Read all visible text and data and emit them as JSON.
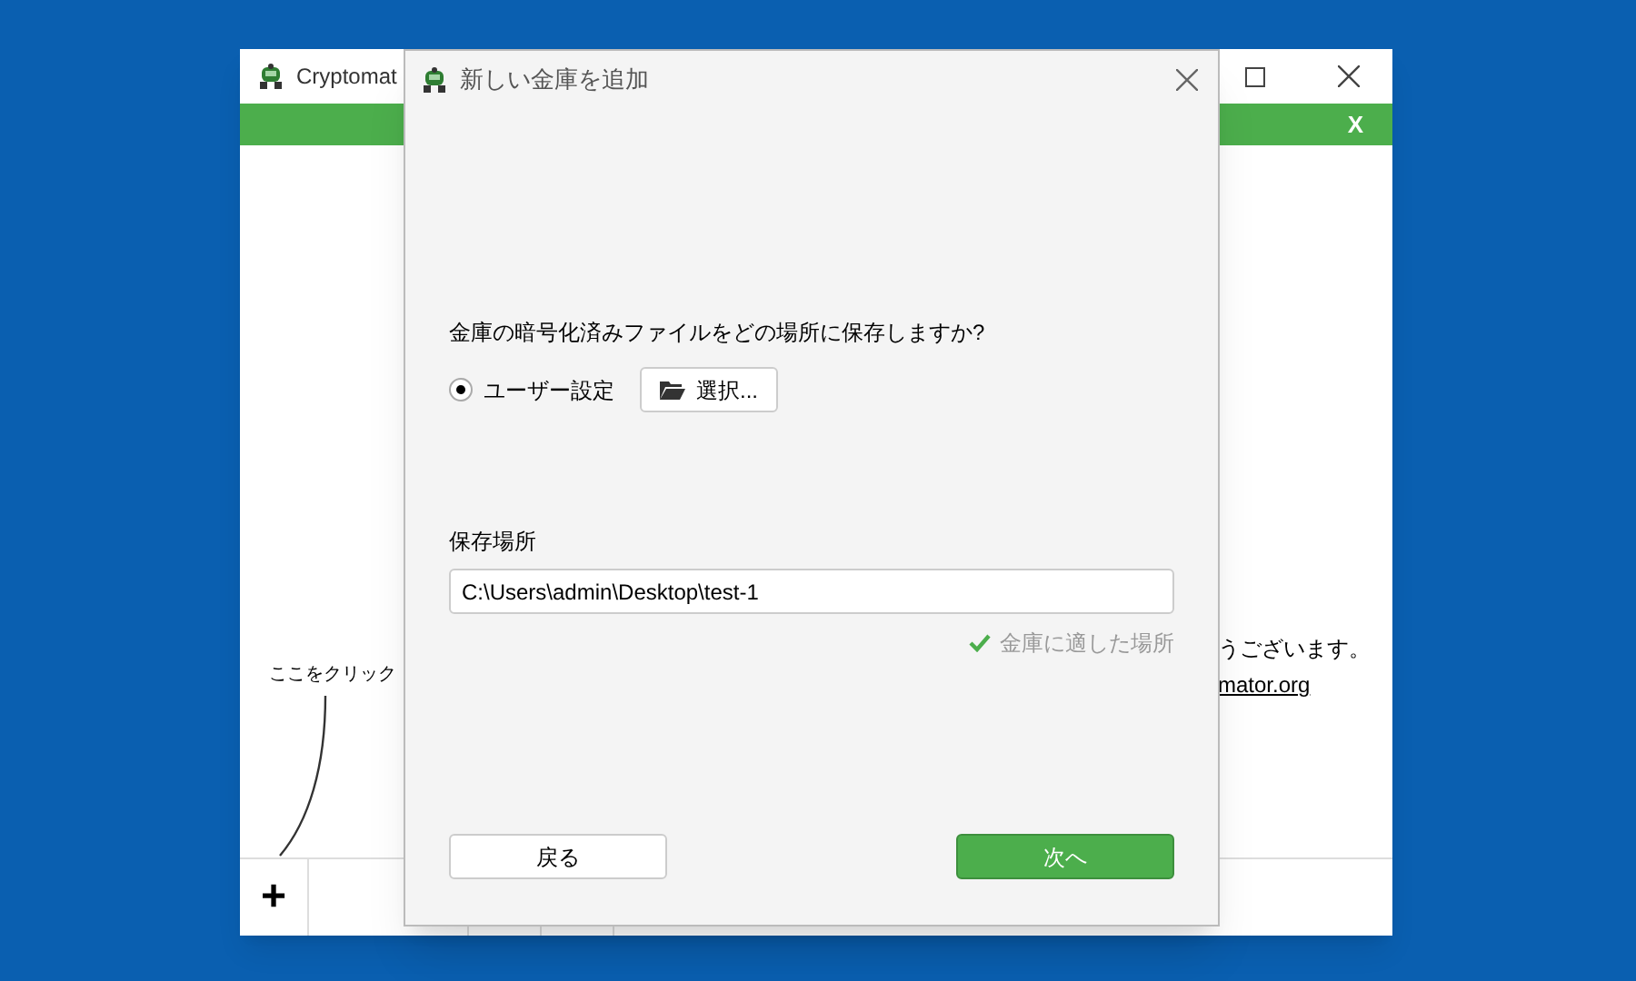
{
  "main_window": {
    "title": "Cryptomat",
    "banner_close": "X",
    "hint": "ここをクリック",
    "welcome_line": "うございます。",
    "link": "mator.org",
    "add_button": "+"
  },
  "dialog": {
    "title": "新しい金庫を追加",
    "question": "金庫の暗号化済みファイルをどの場所に保存しますか?",
    "options": [
      {
        "label": "ユーザー設定",
        "selected": true
      }
    ],
    "choose_button": "選択...",
    "location_label": "保存場所",
    "location_value": "C:\\Users\\admin\\Desktop\\test-1",
    "status": {
      "kind": "valid",
      "text": "金庫に適した場所"
    },
    "back_button": "戻る",
    "next_button": "次へ"
  }
}
